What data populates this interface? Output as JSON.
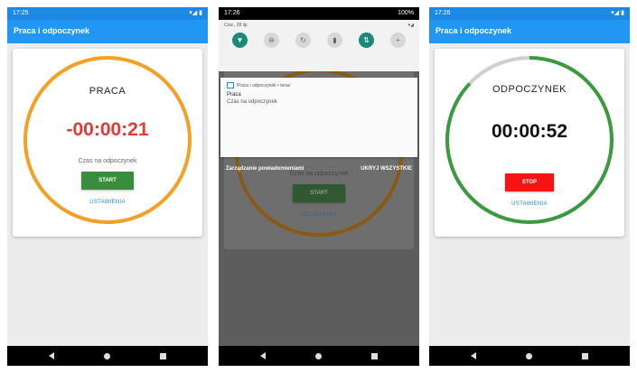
{
  "phone1": {
    "status_time": "17:25",
    "status_icons": "▾◢ ▮",
    "app_title": "Praca i odpoczynek",
    "mode": "PRACA",
    "timer": "-00:00:21",
    "hint": "Czas na odpoczynek",
    "start_label": "START",
    "settings_label": "USTAWIENIA",
    "ring_color": "#f4a025",
    "timer_color": "#e53935",
    "button_color": "#388e3c"
  },
  "phone2": {
    "status_time": "17:26",
    "battery": "100%",
    "date": "Czw., 28 lip",
    "quick_icons": [
      "wifi-icon",
      "dnd-icon",
      "rotate-icon",
      "battery-saver-icon",
      "data-icon",
      "add-icon"
    ],
    "notif_app": "Praca i odpoczynek • teraz",
    "notif_title": "Praca",
    "notif_text": "Czas na odpoczynek",
    "manage_label": "Zarządzanie powiadomieniami",
    "hide_all_label": "UKRYJ WSZYSTKIE",
    "bg_hint": "Czas na odpoczynek",
    "bg_start": "START",
    "bg_settings": "USTAWIENIA"
  },
  "phone3": {
    "status_time": "17:26",
    "status_icons": "▾◢ ▮",
    "app_title": "Praca i odpoczynek",
    "mode": "ODPOCZYNEK",
    "timer": "00:00:52",
    "stop_label": "STOP",
    "settings_label": "USTAWIENIA",
    "ring_color": "#3a9a3e",
    "ring_track_color": "#cfcfcf",
    "ring_progress": 0.87,
    "button_color": "#f51313"
  }
}
